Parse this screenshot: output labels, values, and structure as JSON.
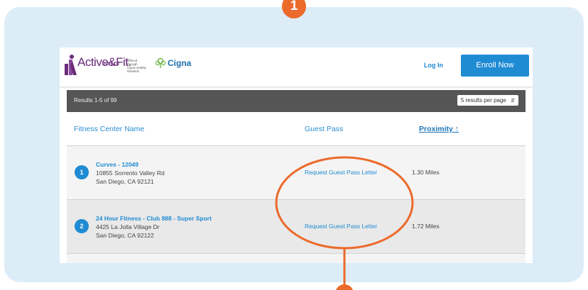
{
  "step_badge": "1",
  "header": {
    "logo_text": "Active&Fit.",
    "logo_sub": "DIRECT",
    "offered_line1": "Offered through",
    "offered_line2": "Cigna Healthy",
    "offered_line3": "Rewards",
    "partner": "Cigna",
    "login_label": "Log In",
    "enroll_label": "Enroll Now"
  },
  "results": {
    "count_text": "Results 1-5 of 99",
    "per_page": "5 results per page"
  },
  "columns": {
    "name": "Fitness Center Name",
    "guest": "Guest Pass",
    "proximity": "Proximity ↑"
  },
  "rows": [
    {
      "num": "1",
      "name": "Curves - 12049",
      "address1": "10855 Sorrento Valley Rd",
      "address2": "San Diego, CA 92121",
      "guest": "Request Guest Pass Letter",
      "distance": "1.30 Miles"
    },
    {
      "num": "2",
      "name": "24 Hour Fitness - Club 888 - Super Sport",
      "address1": "4425 La Jolla Village Dr",
      "address2": "San Diego, CA 92122",
      "guest": "Request Guest Pass Letter",
      "distance": "1.72 Miles"
    }
  ],
  "colors": {
    "accent": "#ec6a2c",
    "primary": "#1f8bd3",
    "panel": "#dcedf8"
  }
}
